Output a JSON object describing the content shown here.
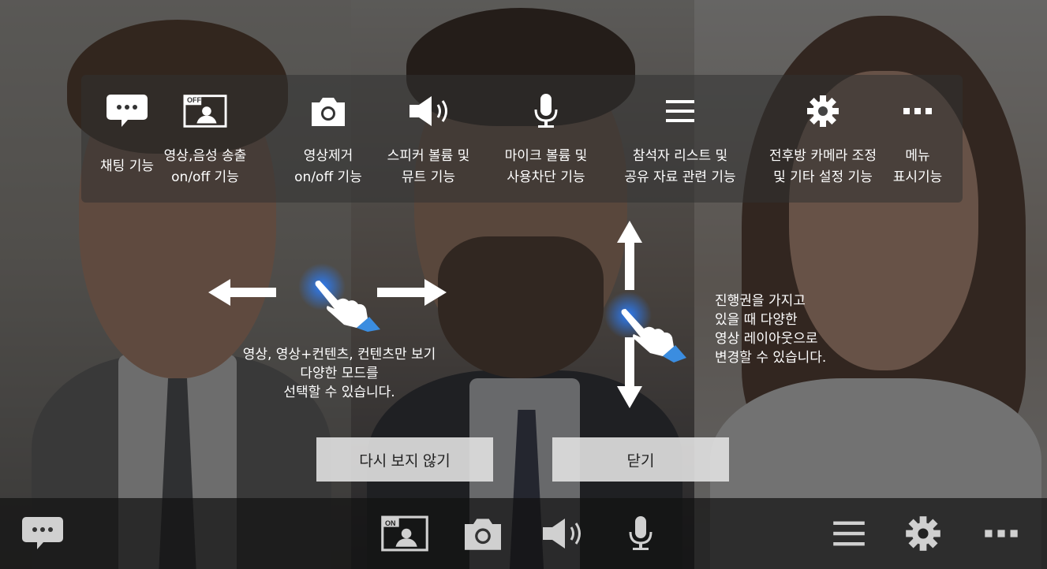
{
  "guide": {
    "items": [
      {
        "icon": "chat-icon",
        "lines": [
          "채팅 기능"
        ]
      },
      {
        "icon": "video-off-icon",
        "badge": "OFF",
        "lines": [
          "영상,음성 송출",
          "on/off 기능"
        ]
      },
      {
        "icon": "camera-icon",
        "lines": [
          "영상제거",
          "on/off 기능"
        ]
      },
      {
        "icon": "speaker-icon",
        "lines": [
          "스피커 볼륨 및",
          "뮤트 기능"
        ]
      },
      {
        "icon": "microphone-icon",
        "lines": [
          "마이크 볼륨 및",
          "사용차단 기능"
        ]
      },
      {
        "icon": "menu-list-icon",
        "lines": [
          "참석자 리스트 및",
          "공유 자료 관련 기능"
        ]
      },
      {
        "icon": "gear-icon",
        "lines": [
          "전후방 카메라 조정",
          "및 기타 설정 기능"
        ]
      },
      {
        "icon": "more-icon",
        "lines": [
          "메뉴",
          "표시기능"
        ]
      }
    ]
  },
  "hints": {
    "swipe_horizontal": [
      "영상, 영상+컨텐츠, 컨텐츠만 보기",
      "다양한 모드를",
      "선택할 수 있습니다."
    ],
    "swipe_vertical": [
      "진행권을 가지고",
      "있을 때 다양한",
      "영상 레이아웃으로",
      "변경할 수 있습니다."
    ]
  },
  "buttons": {
    "dont_show_again": "다시 보지 않기",
    "close": "닫기"
  },
  "toolbar": {
    "video_badge": "ON",
    "icons": [
      "chat-icon",
      "video-on-icon",
      "camera-icon",
      "speaker-icon",
      "microphone-icon",
      "menu-list-icon",
      "gear-icon",
      "more-icon"
    ]
  },
  "colors": {
    "hint_glow": "#2b7fff",
    "hand_cuff": "#3b8de0",
    "button_bg": "#e1e1e1",
    "toolbar_icon": "#d0d0d0"
  }
}
